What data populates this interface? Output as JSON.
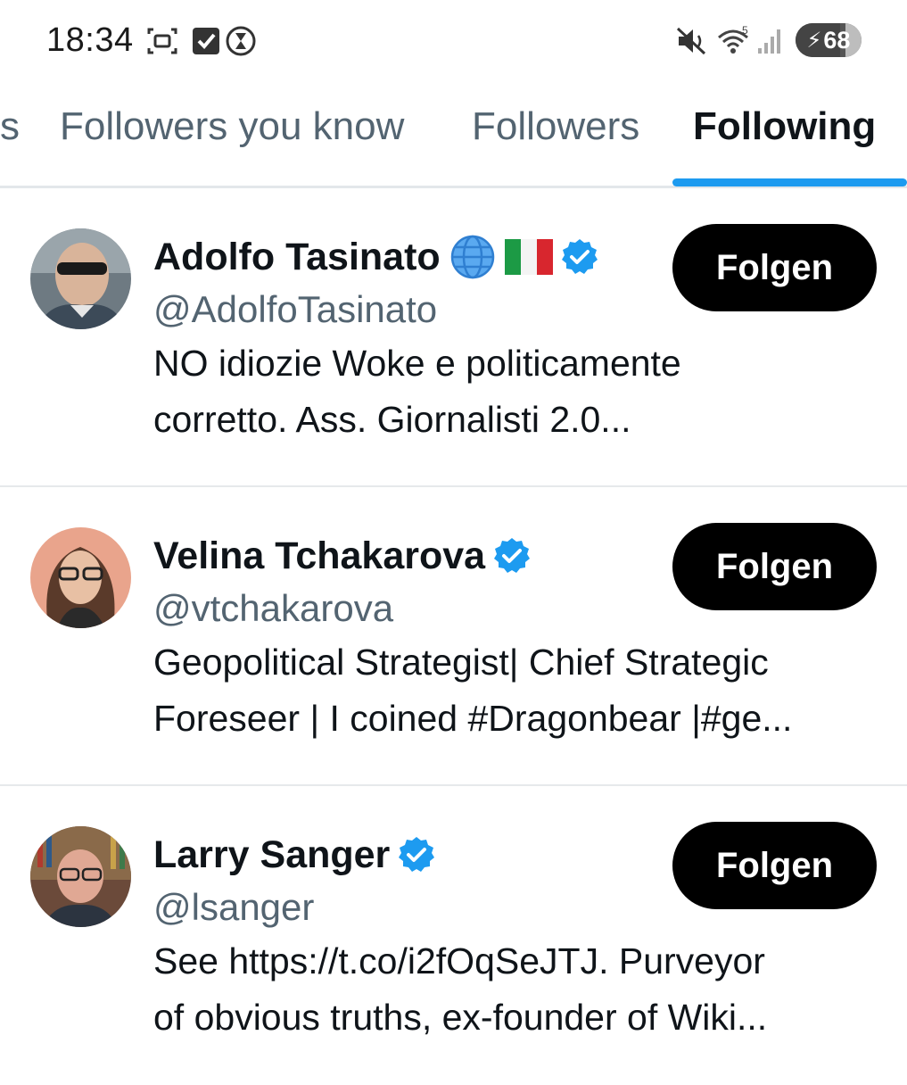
{
  "status_bar": {
    "time": "18:34",
    "battery_level": 68,
    "battery_charging": true,
    "icons": [
      "screenshot-icon",
      "checkbox-icon",
      "hourglass-icon",
      "mute-icon",
      "wifi-icon",
      "signal-icon"
    ]
  },
  "tabs": [
    {
      "label": "s",
      "active": false
    },
    {
      "label": "Followers you know",
      "active": false
    },
    {
      "label": "Followers",
      "active": false
    },
    {
      "label": "Following",
      "active": true
    }
  ],
  "colors": {
    "accent": "#1d9bf0",
    "text_primary": "#0f1419",
    "text_secondary": "#536471",
    "button_bg": "#000000"
  },
  "users": [
    {
      "name": "Adolfo Tasinato",
      "emojis": [
        "globe-icon",
        "italy-flag-icon"
      ],
      "verified": true,
      "handle": "@AdolfoTasinato",
      "bio": [
        "NO idiozie Woke e politicamente",
        "corretto. Ass. Giornalisti 2.0..."
      ],
      "button": "Folgen"
    },
    {
      "name": "Velina Tchakarova",
      "emojis": [],
      "verified": true,
      "handle": "@vtchakarova",
      "bio": [
        "Geopolitical Strategist| Chief Strategic",
        "Foreseer | I coined #Dragonbear |#ge..."
      ],
      "button": "Folgen"
    },
    {
      "name": "Larry Sanger",
      "emojis": [],
      "verified": true,
      "handle": "@lsanger",
      "bio": [
        "See https://t.co/i2fOqSeJTJ. Purveyor",
        "of obvious truths, ex-founder of Wiki..."
      ],
      "button": "Folgen"
    }
  ]
}
